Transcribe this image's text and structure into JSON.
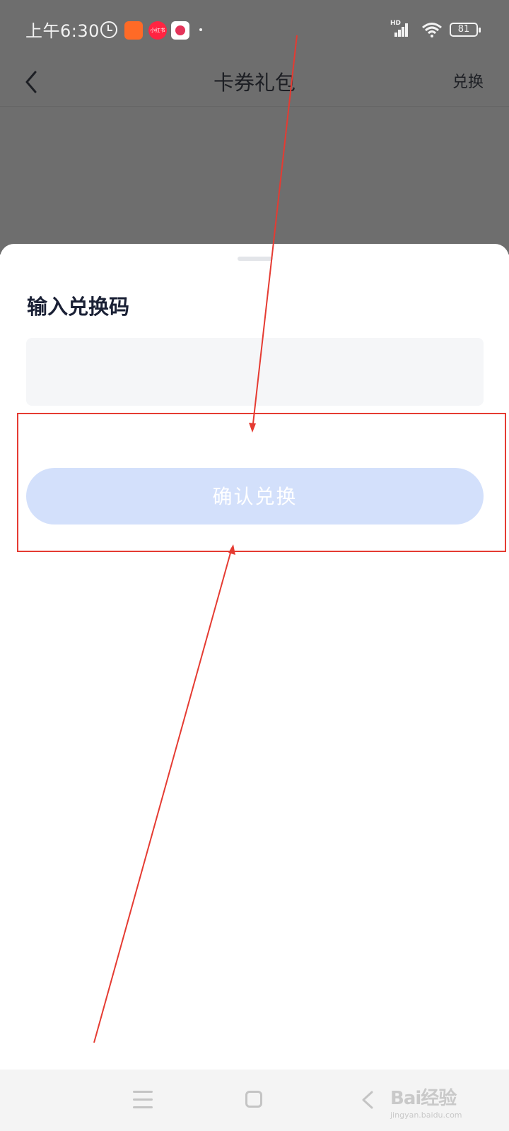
{
  "status_bar": {
    "time": "上午6:30",
    "battery": "81",
    "network": "HD",
    "icons": [
      "alarm-icon",
      "kuaishou-app-icon",
      "xiaohongshu-app-icon",
      "video-app-icon",
      "more-dot-icon",
      "signal-icon",
      "wifi-icon",
      "battery-icon"
    ],
    "xhs_label": "小红书"
  },
  "header": {
    "title": "卡券礼包",
    "action_label": "兑换",
    "back_icon": "chevron-left-icon"
  },
  "sheet": {
    "title": "输入兑换码",
    "input_value": "",
    "input_placeholder": "",
    "confirm_label": "确认兑换"
  },
  "system_nav": {
    "icons": [
      "menu-icon",
      "home-icon",
      "back-icon"
    ],
    "watermark": "Bai经验",
    "watermark_sub": "jingyan.baidu.com"
  },
  "colors": {
    "overlay": "#6e6e6e",
    "confirm_button_bg": "#d3e0fb",
    "input_bg": "#f5f6f8",
    "annotation": "#e53b32",
    "title_text": "#1a2035"
  }
}
